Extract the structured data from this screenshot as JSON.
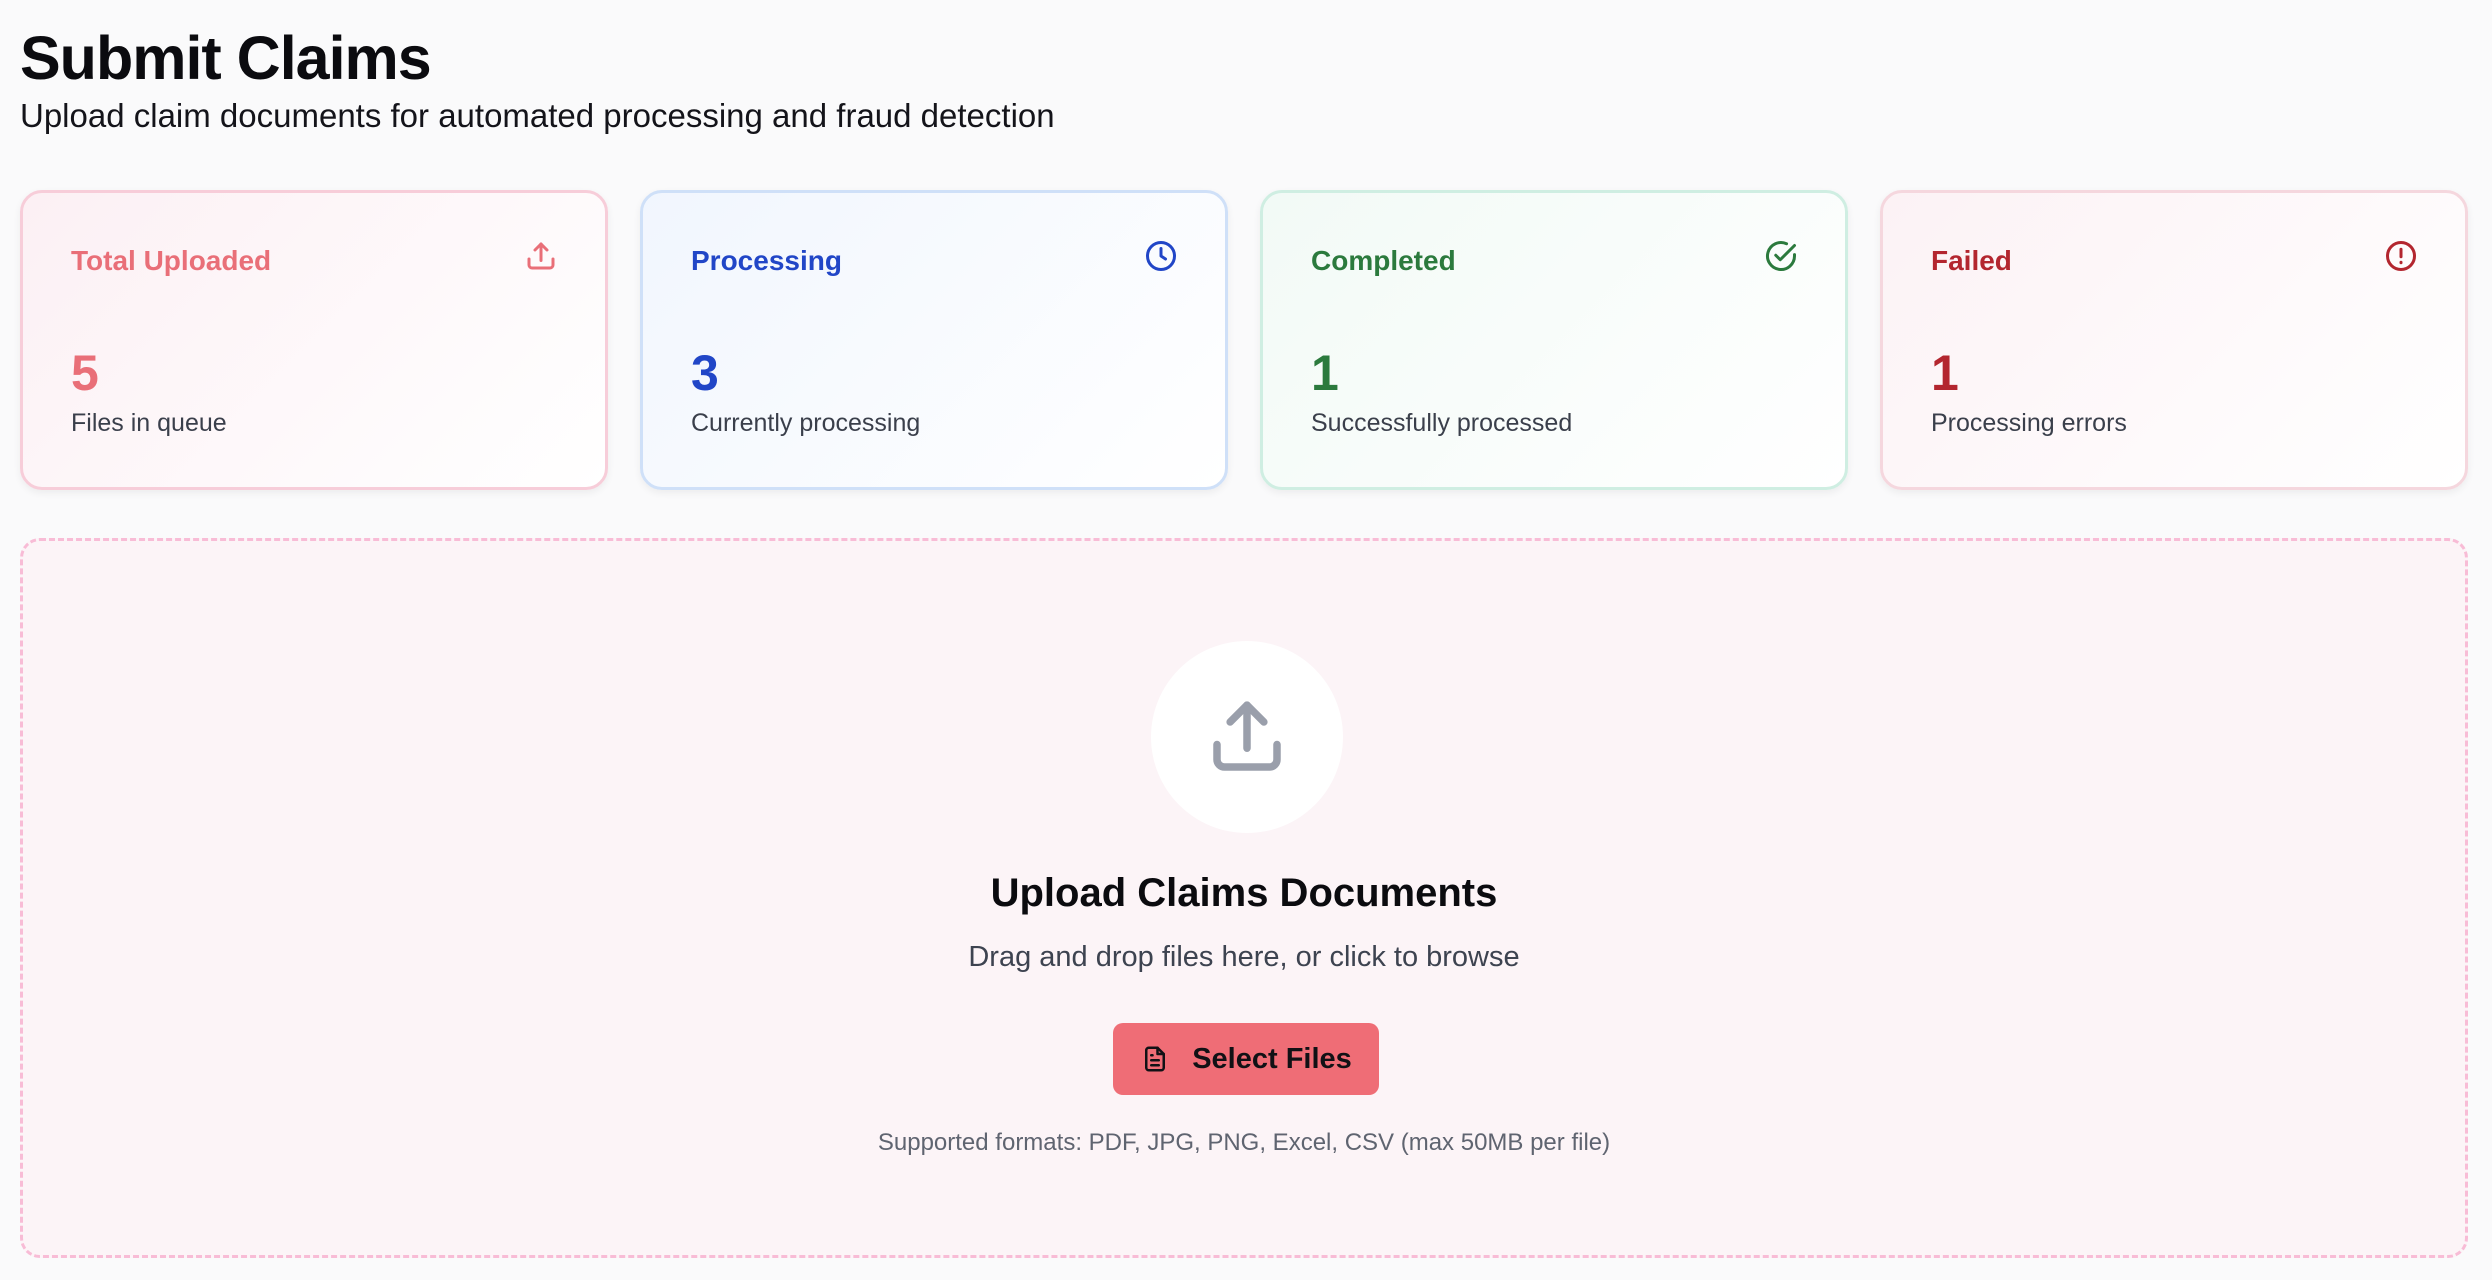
{
  "header": {
    "title": "Submit Claims",
    "subtitle": "Upload claim documents for automated processing and fraud detection"
  },
  "stats": [
    {
      "title": "Total Uploaded",
      "value": "5",
      "caption": "Files in queue",
      "icon": "upload-icon",
      "color": "#e96f78"
    },
    {
      "title": "Processing",
      "value": "3",
      "caption": "Currently processing",
      "icon": "clock-icon",
      "color": "#2146c7"
    },
    {
      "title": "Completed",
      "value": "1",
      "caption": "Successfully processed",
      "icon": "check-circle-icon",
      "color": "#2b7a3d"
    },
    {
      "title": "Failed",
      "value": "1",
      "caption": "Processing errors",
      "icon": "alert-circle-icon",
      "color": "#b3262f"
    }
  ],
  "upload": {
    "title": "Upload Claims Documents",
    "subtitle": "Drag and drop files here, or click to browse",
    "button_label": "Select Files",
    "button_icon": "file-text-icon",
    "formats": "Supported formats: PDF, JPG, PNG, Excel, CSV (max 50MB per file)",
    "icon": "upload-icon",
    "accent_color": "#ef6d76"
  }
}
